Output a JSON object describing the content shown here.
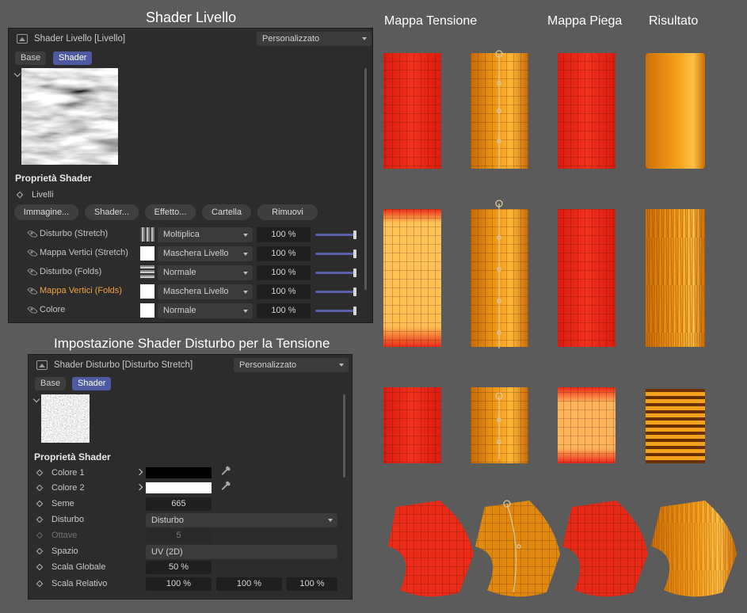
{
  "headings": {
    "shader_livello": "Shader Livello",
    "mappa_tensione": "Mappa Tensione",
    "mappa_piega": "Mappa Piega",
    "risultato": "Risultato",
    "impostazione": "Impostazione Shader Disturbo per la Tensione"
  },
  "panel1": {
    "title": "Shader Livello [Livello]",
    "preset": "Personalizzato",
    "tabs": [
      "Base",
      "Shader"
    ],
    "active_tab": "Shader",
    "section": "Proprietà Shader",
    "livelli_label": "Livelli",
    "buttons": [
      "Immagine...",
      "Shader...",
      "Effetto...",
      "Cartella",
      "Rimuovi"
    ],
    "layers": [
      {
        "name": "Disturbo (Stretch)",
        "mode": "Moltiplica",
        "opacity": "100 %",
        "highlight": false,
        "level": 1.0
      },
      {
        "name": "Mappa Vertici (Stretch)",
        "mode": "Maschera Livello",
        "opacity": "100 %",
        "highlight": false,
        "level": 1.0
      },
      {
        "name": "Disturbo (Folds)",
        "mode": "Normale",
        "opacity": "100 %",
        "highlight": false,
        "level": 1.0
      },
      {
        "name": "Mappa Vertici (Folds)",
        "mode": "Maschera Livello",
        "opacity": "100 %",
        "highlight": true,
        "level": 1.0
      },
      {
        "name": "Colore",
        "mode": "Normale",
        "opacity": "100 %",
        "highlight": false,
        "level": 1.0
      }
    ]
  },
  "panel2": {
    "title": "Shader Disturbo [Disturbo Stretch]",
    "preset": "Personalizzato",
    "tabs": [
      "Base",
      "Shader"
    ],
    "active_tab": "Shader",
    "section": "Proprietà Shader",
    "colore1_label": "Colore 1",
    "colore1_value": "#000000",
    "colore2_label": "Colore 2",
    "colore2_value": "#ffffff",
    "seme_label": "Seme",
    "seme_value": "665",
    "disturbo_label": "Disturbo",
    "disturbo_value": "Disturbo",
    "ottave_label": "Ottave",
    "ottave_value": "5",
    "spazio_label": "Spazio",
    "spazio_value": "UV (2D)",
    "scala_globale_label": "Scala Globale",
    "scala_globale_value": "50 %",
    "scala_relativo_label": "Scala Relativo",
    "scala_relativo_values": [
      "100 %",
      "100 %",
      "100 %"
    ]
  },
  "colors": {
    "accent": "#4d5aa1",
    "highlight": "#f2a23a",
    "tension_red": "#ee2a1a",
    "orange": "#e0860c",
    "yellow": "#ffc457"
  }
}
